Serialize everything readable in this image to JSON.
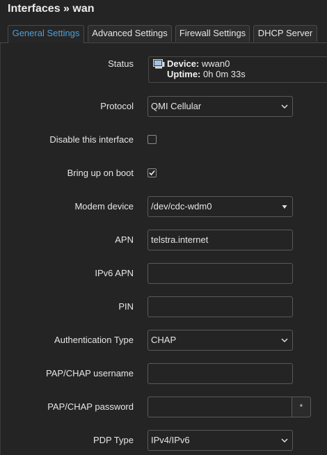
{
  "page": {
    "title": "Interfaces » wan"
  },
  "tabs": [
    {
      "label": "General Settings",
      "active": true
    },
    {
      "label": "Advanced Settings",
      "active": false
    },
    {
      "label": "Firewall Settings",
      "active": false
    },
    {
      "label": "DHCP Server",
      "active": false
    }
  ],
  "status": {
    "label": "Status",
    "device_key": "Device:",
    "device_value": "wwan0",
    "uptime_key": "Uptime:",
    "uptime_value": "0h 0m 33s"
  },
  "protocol": {
    "label": "Protocol",
    "value": "QMI Cellular"
  },
  "disable_interface": {
    "label": "Disable this interface",
    "checked": false
  },
  "bring_up_on_boot": {
    "label": "Bring up on boot",
    "checked": true
  },
  "modem_device": {
    "label": "Modem device",
    "value": "/dev/cdc-wdm0"
  },
  "apn": {
    "label": "APN",
    "value": "telstra.internet"
  },
  "ipv6_apn": {
    "label": "IPv6 APN",
    "value": ""
  },
  "pin": {
    "label": "PIN",
    "value": ""
  },
  "auth_type": {
    "label": "Authentication Type",
    "value": "CHAP"
  },
  "pap_chap_username": {
    "label": "PAP/CHAP username",
    "value": ""
  },
  "pap_chap_password": {
    "label": "PAP/CHAP password",
    "value": "",
    "reveal_glyph": "*"
  },
  "pdp_type": {
    "label": "PDP Type",
    "value": "IPv4/IPv6"
  },
  "colors": {
    "accent": "#4f9fd8",
    "background": "#242424",
    "border": "#5a5a5a"
  }
}
